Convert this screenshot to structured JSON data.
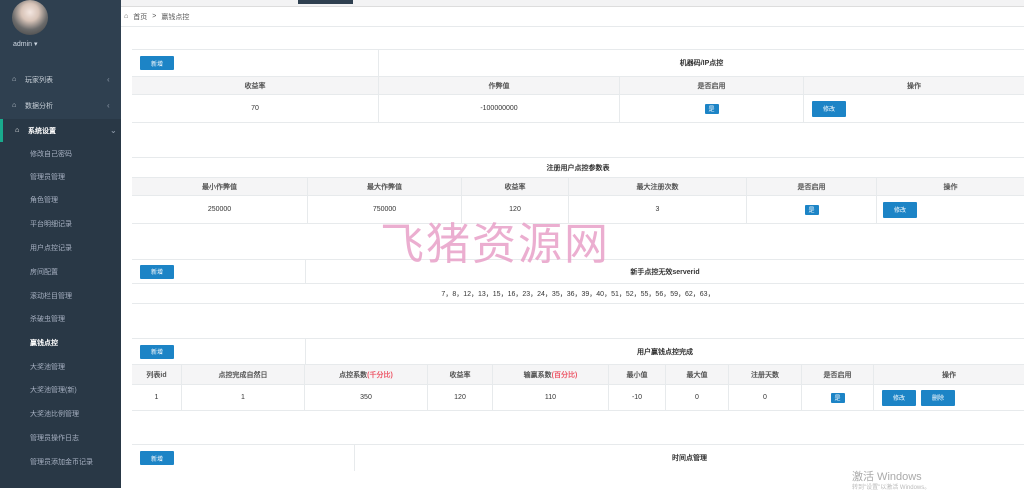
{
  "sidebar": {
    "user": "admin ▾",
    "menu": [
      {
        "label": "玩家列表",
        "chevron": "‹"
      },
      {
        "label": "数据分析",
        "chevron": "‹"
      },
      {
        "label": "系统设置",
        "chevron": "⌄"
      }
    ],
    "submenu": [
      "修改自己密码",
      "管理员管理",
      "角色管理",
      "平台明细记录",
      "用户点控记录",
      "房间配置",
      "滚动栏目管理",
      "杀破虫管理",
      "赢钱点控",
      "大奖池管理",
      "大奖池管理(新)",
      "大奖池比例管理",
      "管理员操作日志",
      "管理员添加金币记录"
    ]
  },
  "breadcrumb": {
    "home": "首页",
    "sep": ">",
    "current": "赢钱点控"
  },
  "section1": {
    "add_label": "新增",
    "title": "机器码/IP点控",
    "headers": [
      "收益率",
      "作弊值",
      "是否启用",
      "操作"
    ],
    "row": {
      "rate": "70",
      "cheat": "-100000000",
      "enabled": "是",
      "action": "修改"
    }
  },
  "section2": {
    "title": "注册用户点控参数表",
    "headers": [
      "最小作弊值",
      "最大作弊值",
      "收益率",
      "最大注册次数",
      "是否启用",
      "操作"
    ],
    "row": {
      "min": "250000",
      "max": "750000",
      "rate": "120",
      "count": "3",
      "enabled": "是",
      "action": "修改"
    }
  },
  "section3": {
    "add_label": "新增",
    "title": "新手点控无效serverid",
    "content": "7，8，12，13，15，16，23，24，35，36，39，40，51，52，55，56，59，62，63，"
  },
  "section4": {
    "add_label": "新增",
    "title": "用户赢钱点控完成",
    "headers": [
      "列表id",
      "点控完成自然日",
      "点控系数",
      "(千分比)",
      "收益率",
      "输赢系数",
      "(百分比)",
      "最小值",
      "最大值",
      "注册天数",
      "是否启用",
      "操作"
    ],
    "row": {
      "id": "1",
      "day": "1",
      "coef": "350",
      "rate": "120",
      "winlose": "110",
      "min": "-10",
      "max": "0",
      "reg": "0",
      "enabled": "是",
      "edit": "修改",
      "del": "删除"
    }
  },
  "section5": {
    "add_label": "新增",
    "title": "时间点管理"
  },
  "watermark": "飞猪资源网",
  "windows": {
    "line1": "激活 Windows",
    "line2": "转到\"设置\"以激活 Windows。"
  }
}
